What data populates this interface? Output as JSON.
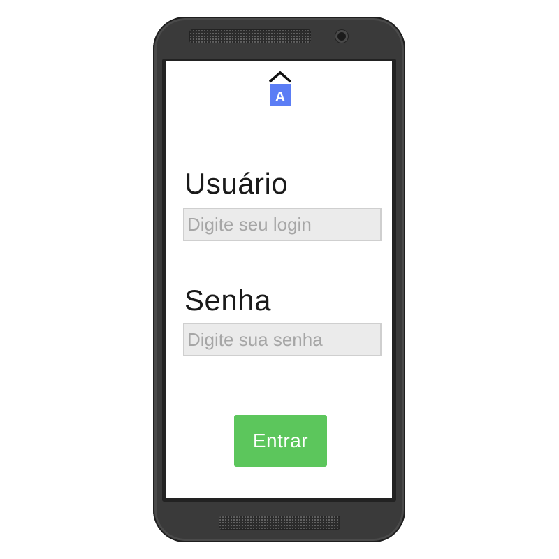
{
  "app": {
    "logo_icon": "house-letter-a-icon",
    "logo_letter": "A",
    "accent_color": "#5b7df5"
  },
  "login": {
    "username_label": "Usuário",
    "username_placeholder": "Digite seu login",
    "password_label": "Senha",
    "password_placeholder": "Digite sua senha",
    "submit_label": "Entrar",
    "submit_color": "#5cc65c"
  }
}
